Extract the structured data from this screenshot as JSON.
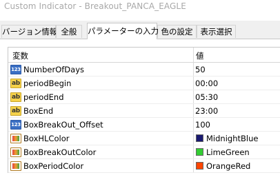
{
  "window": {
    "title": "Custom Indicator - Breakout_PANCA_EAGLE"
  },
  "tabs": [
    {
      "label": "バージョン情報",
      "active": false
    },
    {
      "label": "全般",
      "active": false
    },
    {
      "label": "パラメーターの入力",
      "active": true
    },
    {
      "label": "色の設定",
      "active": false
    },
    {
      "label": "表示選択",
      "active": false
    }
  ],
  "grid": {
    "headers": {
      "variable": "変数",
      "value": "値"
    },
    "rows": [
      {
        "name": "NumberOfDays",
        "value": "50",
        "type": "int",
        "icon": "int-type-icon",
        "icon_text": "123"
      },
      {
        "name": "periodBegin",
        "value": "00:00",
        "type": "string",
        "icon": "string-type-icon",
        "icon_text": "ab"
      },
      {
        "name": "periodEnd",
        "value": "05:30",
        "type": "string",
        "icon": "string-type-icon",
        "icon_text": "ab"
      },
      {
        "name": "BoxEnd",
        "value": "23:00",
        "type": "string",
        "icon": "string-type-icon",
        "icon_text": "ab"
      },
      {
        "name": "BoxBreakOut_Offset",
        "value": "100",
        "type": "int",
        "icon": "int-type-icon",
        "icon_text": "123"
      },
      {
        "name": "BoxHLColor",
        "value": "MidnightBlue",
        "type": "color",
        "icon": "color-type-icon",
        "swatch": "#191970"
      },
      {
        "name": "BoxBreakOutColor",
        "value": "LimeGreen",
        "type": "color",
        "icon": "color-type-icon",
        "swatch": "#32cd32"
      },
      {
        "name": "BoxPeriodColor",
        "value": "OrangeRed",
        "type": "color",
        "icon": "color-type-icon",
        "swatch": "#ff4500"
      }
    ]
  }
}
